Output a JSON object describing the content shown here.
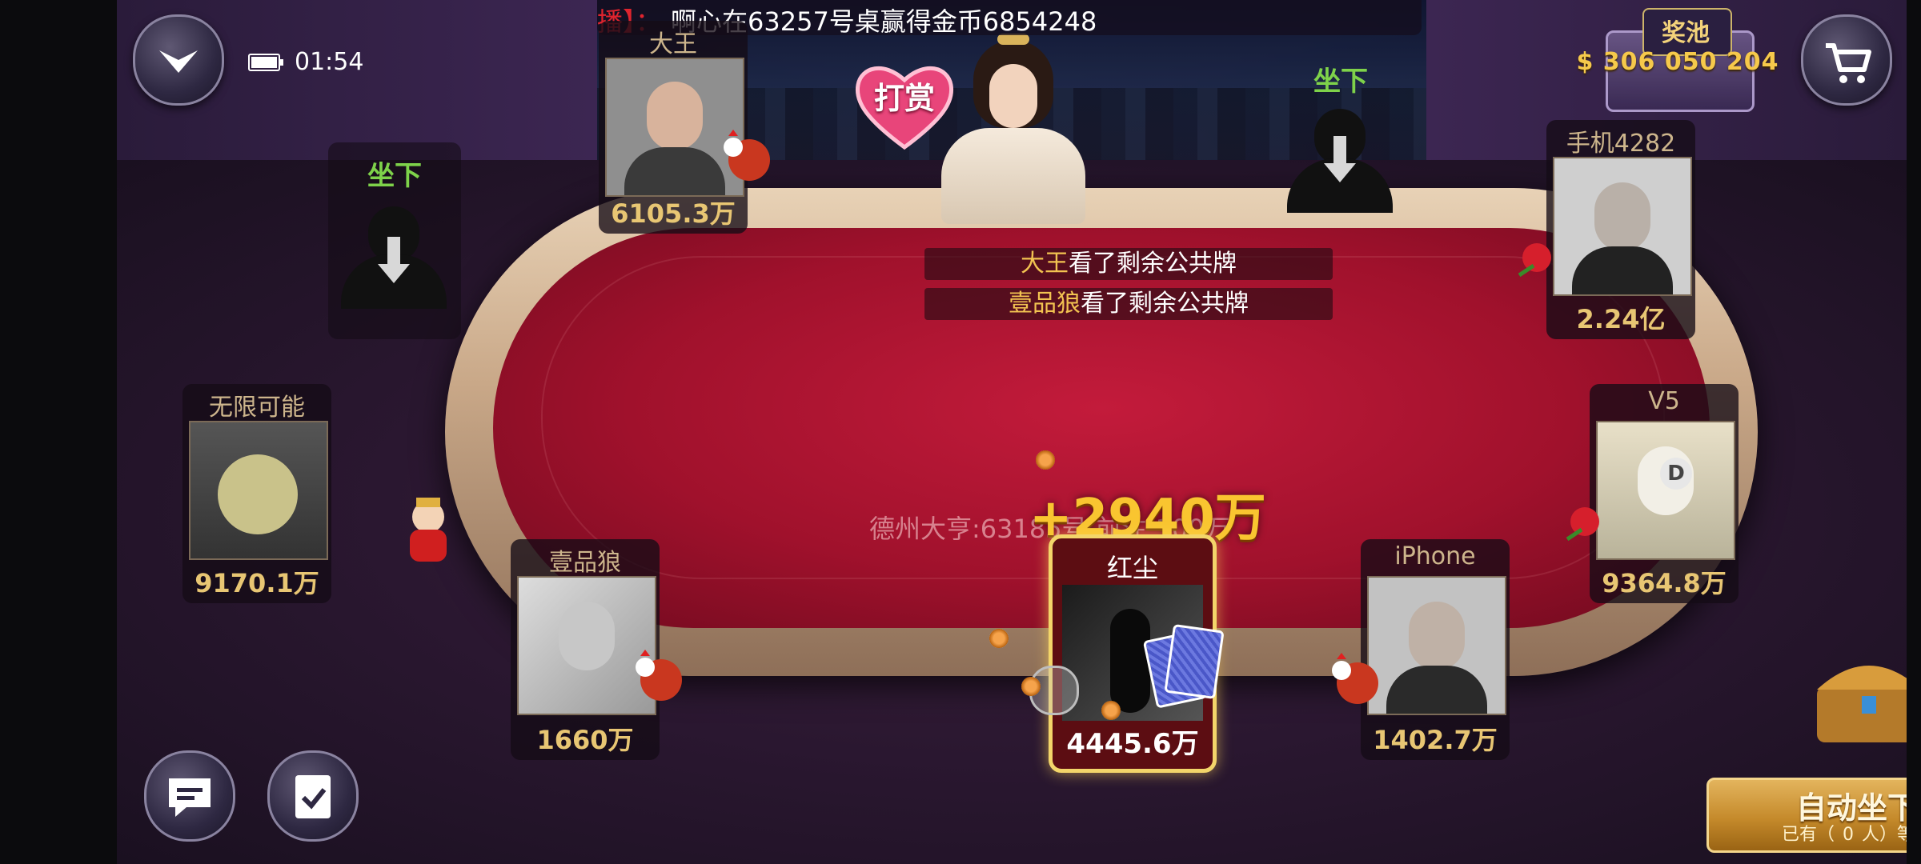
{
  "status_bar": {
    "time": "01:54"
  },
  "broadcast": {
    "prefix": "播】：",
    "message": "啊心在63257号桌赢得金币6854248"
  },
  "jackpot": {
    "label": "奖池",
    "amount": "$ 306 050 204"
  },
  "tip_button": {
    "label": "打赏"
  },
  "empty_seats": [
    {
      "label": "坐下"
    },
    {
      "label": "坐下"
    }
  ],
  "players": [
    {
      "name": "大王",
      "chips": "6105.3万"
    },
    {
      "name": "手机4282",
      "chips": "2.24亿"
    },
    {
      "name": "无限可能",
      "chips": "9170.1万"
    },
    {
      "name": "V5",
      "chips": "9364.8万"
    },
    {
      "name": "壹品狼",
      "chips": "1660万"
    },
    {
      "name": "iPhone",
      "chips": "1402.7万"
    }
  ],
  "me": {
    "name": "红尘",
    "chips": "4445.6万"
  },
  "log": [
    {
      "who": "大王",
      "action": "看了剩余公共牌"
    },
    {
      "who": "壹品狼",
      "action": "看了剩余公共牌"
    }
  ],
  "win_amount": "+2940万",
  "table_info": "德州大亨:63185号 前注:100万",
  "dealer_marker": "D",
  "auto_sit": {
    "label": "自动坐下",
    "wait_prefix": "已有（",
    "wait_count": "0",
    "wait_suffix": "人）等待"
  },
  "colors": {
    "accent_gold": "#f3d56a",
    "sit_green": "#7ed24a",
    "felt_red": "#a0112c",
    "broadcast_red": "#e0242e"
  },
  "icons": [
    "chevron-down-icon",
    "battery-icon",
    "cart-icon",
    "chat-icon",
    "task-icon",
    "treasure-icon",
    "heart-icon"
  ]
}
